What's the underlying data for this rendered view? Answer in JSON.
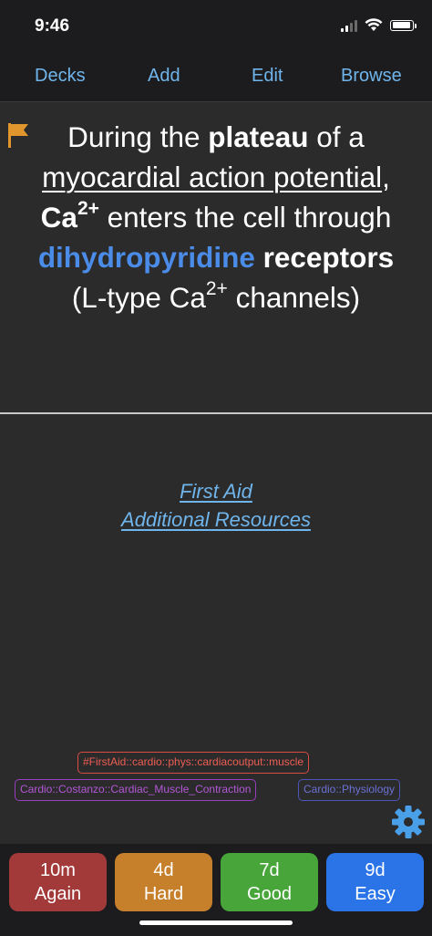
{
  "status": {
    "time": "9:46"
  },
  "nav": {
    "decks": "Decks",
    "add": "Add",
    "edit": "Edit",
    "browse": "Browse"
  },
  "card": {
    "question": {
      "line1_pre": "During the ",
      "line1_bold": "plateau",
      "line1_post": " of a",
      "line2_underlined": "myocardial action potential",
      "line2_post": ",",
      "line3_ion": "Ca",
      "line3_charge": "2+",
      "line3_post": " enters the cell through",
      "line4_blue": "dihydropyridine",
      "line4_bold": " receptors",
      "line5_pre": "(L-type Ca",
      "line5_charge": "2+",
      "line5_post": " channels)"
    },
    "links": {
      "first_aid": "First Aid",
      "additional_resources": "Additional Resources"
    },
    "tags": [
      "#FirstAid::cardio::phys::cardiacoutput::muscle",
      "Cardio::Costanzo::Cardiac_Muscle_Contraction",
      "Cardio::Physiology"
    ]
  },
  "answers": [
    {
      "interval": "10m",
      "label": "Again"
    },
    {
      "interval": "4d",
      "label": "Hard"
    },
    {
      "interval": "7d",
      "label": "Good"
    },
    {
      "interval": "9d",
      "label": "Easy"
    }
  ],
  "colors": {
    "again": "#a33a3a",
    "hard": "#c67f2b",
    "good": "#47a53a",
    "easy": "#2a74e8",
    "link": "#6fb5ec",
    "flag": "#e0962c",
    "gear": "#4aa0e8"
  },
  "icons": {
    "flag": "flag-icon",
    "gear": "gear-icon",
    "signal": "cellular-signal-icon",
    "wifi": "wifi-icon",
    "battery": "battery-icon"
  }
}
